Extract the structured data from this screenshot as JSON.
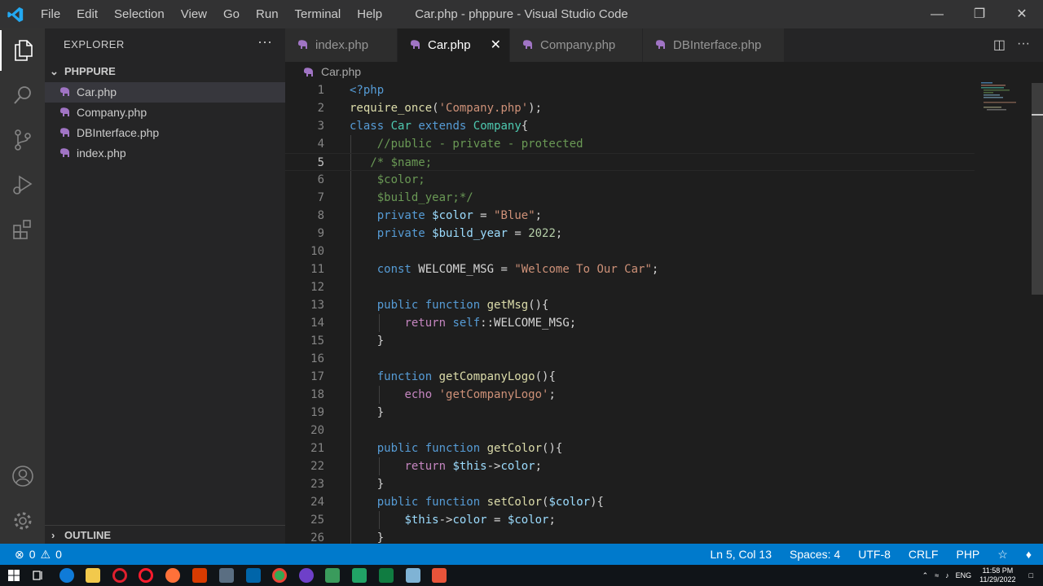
{
  "titlebar": {
    "menu": [
      "File",
      "Edit",
      "Selection",
      "View",
      "Go",
      "Run",
      "Terminal",
      "Help"
    ],
    "window_title": "Car.php - phppure - Visual Studio Code"
  },
  "activity_bar": {
    "items": [
      "explorer-icon",
      "search-icon",
      "source-control-icon",
      "run-debug-icon",
      "extensions-icon",
      "account-icon",
      "manage-gear-icon"
    ]
  },
  "sidebar": {
    "title": "EXPLORER",
    "more": "···",
    "folder": "PHPPURE",
    "files": [
      "Car.php",
      "Company.php",
      "DBInterface.php",
      "index.php"
    ],
    "outline": "OUTLINE"
  },
  "tabs": [
    {
      "label": "index.php",
      "active": false
    },
    {
      "label": "Car.php",
      "active": true
    },
    {
      "label": "Company.php",
      "active": false
    },
    {
      "label": "DBInterface.php",
      "active": false
    }
  ],
  "breadcrumb": "Car.php",
  "editor": {
    "current_line": 5,
    "lines": [
      {
        "n": "1",
        "tokens": [
          [
            "kw",
            "<?php"
          ]
        ]
      },
      {
        "n": "2",
        "tokens": [
          [
            "fn",
            "require_once"
          ],
          [
            "",
            "("
          ],
          [
            "str",
            "'Company.php'"
          ],
          [
            "",
            ");"
          ]
        ]
      },
      {
        "n": "3",
        "tokens": [
          [
            "kw",
            "class"
          ],
          [
            "",
            " "
          ],
          [
            "cls",
            "Car"
          ],
          [
            "",
            " "
          ],
          [
            "kw",
            "extends"
          ],
          [
            "",
            " "
          ],
          [
            "cls",
            "Company"
          ],
          [
            "",
            "{"
          ]
        ]
      },
      {
        "n": "4",
        "tokens": [
          [
            "",
            "    "
          ],
          [
            "cmt",
            "//public - private - protected"
          ]
        ]
      },
      {
        "n": "5",
        "tokens": [
          [
            "",
            "   "
          ],
          [
            "cmt",
            "/* $name;"
          ]
        ]
      },
      {
        "n": "6",
        "tokens": [
          [
            "",
            "    "
          ],
          [
            "cmt",
            "$color;"
          ]
        ]
      },
      {
        "n": "7",
        "tokens": [
          [
            "",
            "    "
          ],
          [
            "cmt",
            "$build_year;*/"
          ]
        ]
      },
      {
        "n": "8",
        "tokens": [
          [
            "",
            "    "
          ],
          [
            "kw",
            "private"
          ],
          [
            "",
            " "
          ],
          [
            "var",
            "$color"
          ],
          [
            "",
            " = "
          ],
          [
            "str",
            "\"Blue\""
          ],
          [
            "",
            ";"
          ]
        ]
      },
      {
        "n": "9",
        "tokens": [
          [
            "",
            "    "
          ],
          [
            "kw",
            "private"
          ],
          [
            "",
            " "
          ],
          [
            "var",
            "$build_year"
          ],
          [
            "",
            " = "
          ],
          [
            "num",
            "2022"
          ],
          [
            "",
            ";"
          ]
        ]
      },
      {
        "n": "10",
        "tokens": []
      },
      {
        "n": "11",
        "tokens": [
          [
            "",
            "    "
          ],
          [
            "kw",
            "const"
          ],
          [
            "",
            " WELCOME_MSG = "
          ],
          [
            "str",
            "\"Welcome To Our Car\""
          ],
          [
            "",
            ";"
          ]
        ]
      },
      {
        "n": "12",
        "tokens": []
      },
      {
        "n": "13",
        "tokens": [
          [
            "",
            "    "
          ],
          [
            "kw",
            "public"
          ],
          [
            "",
            " "
          ],
          [
            "kw",
            "function"
          ],
          [
            "",
            " "
          ],
          [
            "fn",
            "getMsg"
          ],
          [
            "",
            "(){"
          ]
        ]
      },
      {
        "n": "14",
        "tokens": [
          [
            "",
            "        "
          ],
          [
            "ctl",
            "return"
          ],
          [
            "",
            " "
          ],
          [
            "kw",
            "self"
          ],
          [
            "",
            "::WELCOME_MSG;"
          ]
        ]
      },
      {
        "n": "15",
        "tokens": [
          [
            "",
            "    }"
          ]
        ]
      },
      {
        "n": "16",
        "tokens": []
      },
      {
        "n": "17",
        "tokens": [
          [
            "",
            "    "
          ],
          [
            "kw",
            "function"
          ],
          [
            "",
            " "
          ],
          [
            "fn",
            "getCompanyLogo"
          ],
          [
            "",
            "(){"
          ]
        ]
      },
      {
        "n": "18",
        "tokens": [
          [
            "",
            "        "
          ],
          [
            "ctl",
            "echo"
          ],
          [
            "",
            " "
          ],
          [
            "str",
            "'getCompanyLogo'"
          ],
          [
            "",
            ";"
          ]
        ]
      },
      {
        "n": "19",
        "tokens": [
          [
            "",
            "    }"
          ]
        ]
      },
      {
        "n": "20",
        "tokens": []
      },
      {
        "n": "21",
        "tokens": [
          [
            "",
            "    "
          ],
          [
            "kw",
            "public"
          ],
          [
            "",
            " "
          ],
          [
            "kw",
            "function"
          ],
          [
            "",
            " "
          ],
          [
            "fn",
            "getColor"
          ],
          [
            "",
            "(){"
          ]
        ]
      },
      {
        "n": "22",
        "tokens": [
          [
            "",
            "        "
          ],
          [
            "ctl",
            "return"
          ],
          [
            "",
            " "
          ],
          [
            "var",
            "$this"
          ],
          [
            "",
            "->"
          ],
          [
            "var",
            "color"
          ],
          [
            "",
            ";"
          ]
        ]
      },
      {
        "n": "23",
        "tokens": [
          [
            "",
            "    }"
          ]
        ]
      },
      {
        "n": "24",
        "tokens": [
          [
            "",
            "    "
          ],
          [
            "kw",
            "public"
          ],
          [
            "",
            " "
          ],
          [
            "kw",
            "function"
          ],
          [
            "",
            " "
          ],
          [
            "fn",
            "setColor"
          ],
          [
            "",
            "("
          ],
          [
            "var",
            "$color"
          ],
          [
            "",
            "){"
          ]
        ]
      },
      {
        "n": "25",
        "tokens": [
          [
            "",
            "        "
          ],
          [
            "var",
            "$this"
          ],
          [
            "",
            "->"
          ],
          [
            "var",
            "color"
          ],
          [
            "",
            " = "
          ],
          [
            "var",
            "$color"
          ],
          [
            "",
            ";"
          ]
        ]
      },
      {
        "n": "26",
        "tokens": [
          [
            "",
            "    }"
          ]
        ]
      }
    ]
  },
  "statusbar": {
    "errors": "0",
    "warnings": "0",
    "position": "Ln 5, Col 13",
    "spaces": "Spaces: 4",
    "encoding": "UTF-8",
    "eol": "CRLF",
    "language": "PHP"
  },
  "taskbar": {
    "apps": [
      "start-icon",
      "task-view-icon",
      "edge-icon",
      "file-explorer-icon",
      "opera-icon",
      "opera-gx-icon",
      "firefox-icon",
      "app-icon",
      "calculator-icon",
      "vscode-icon",
      "chrome-icon",
      "github-icon",
      "app-icon",
      "spreadsheet-icon",
      "excel-icon",
      "notepad-icon",
      "app-icon"
    ],
    "lang": "ENG",
    "time": "11:58 PM",
    "date": "11/29/2022"
  },
  "colors": {
    "accent": "#007acc",
    "php_icon": "#a074c4"
  }
}
